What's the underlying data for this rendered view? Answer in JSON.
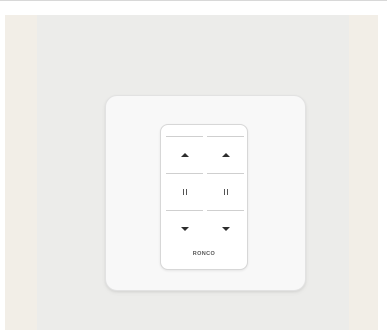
{
  "device": {
    "brand": "RONCO",
    "type": "wall-mounted blind control keypad"
  },
  "controls": {
    "left_column": [
      "up-icon",
      "pause-icon",
      "down-icon"
    ],
    "right_column": [
      "up-icon",
      "pause-icon",
      "down-icon"
    ]
  },
  "colors": {
    "plate": "#f8f8f8",
    "keypad": "#ffffff",
    "background": "#f2eee7",
    "icon": "#2d2d2d"
  }
}
